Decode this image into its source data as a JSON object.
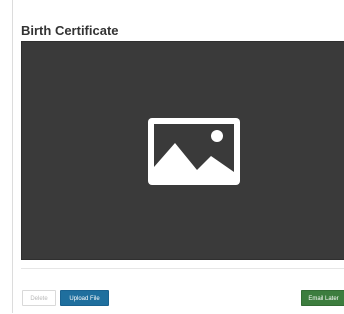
{
  "panel": {
    "title": "Birth Certificate"
  },
  "preview": {
    "icon": "image-placeholder-icon",
    "background_color": "#3a3a3a"
  },
  "actions": {
    "delete_label": "Delete",
    "upload_label": "Upload File",
    "email_later_label": "Email Later"
  },
  "colors": {
    "upload_button": "#1f6f9e",
    "email_later_button": "#3c7d3e",
    "title_text": "#333333"
  }
}
